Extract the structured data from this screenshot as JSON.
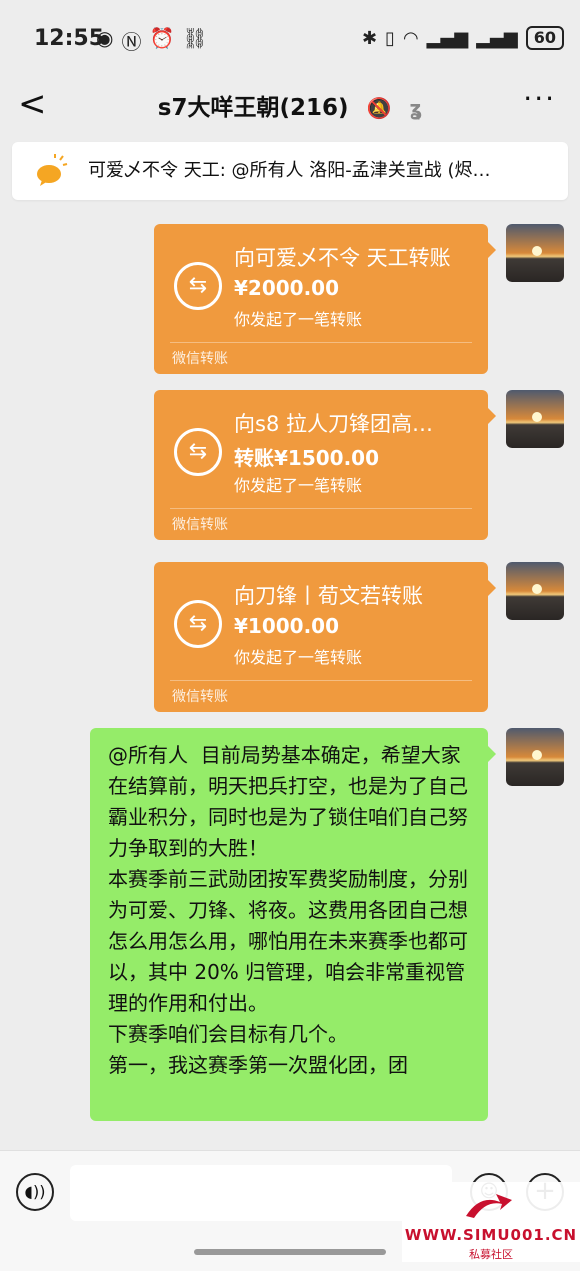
{
  "status": {
    "time": "12:55",
    "battery": "60",
    "left_icons": [
      "eye-icon",
      "nfc-icon",
      "alarm-icon",
      "link-icon"
    ],
    "right_icons": [
      "bluetooth-icon",
      "vibrate-icon",
      "wifi-icon",
      "signal-5g-icon",
      "signal-5g-icon"
    ]
  },
  "nav": {
    "back_glyph": "<",
    "title": "s7大咩王朝(216)",
    "more_glyph": "···"
  },
  "announcement": {
    "text": "可爱乄不令 天工: @所有人 洛阳-孟津关宣战 (烬…"
  },
  "messages": [
    {
      "type": "transfer",
      "title": "向可爱乄不令 天工转账",
      "amount": "¥2000.00",
      "note": "你发起了一笔转账",
      "footer": "微信转账"
    },
    {
      "type": "transfer",
      "title": "向s8 拉人刀锋团高…",
      "amount": "转账¥1500.00",
      "note": "你发起了一笔转账",
      "footer": "微信转账"
    },
    {
      "type": "transfer",
      "title": "向刀锋丨荀文若转账",
      "amount": "¥1000.00",
      "note": "你发起了一笔转账",
      "footer": "微信转账"
    },
    {
      "type": "text",
      "text": "@所有人  目前局势基本确定，希望大家在结算前，明天把兵打空，也是为了自己霸业积分，同时也是为了锁住咱们自己努力争取到的大胜！\n本赛季前三武勋团按军费奖励制度，分别为可爱、刀锋、将夜。这费用各团自己想怎么用怎么用，哪怕用在未来赛季也都可以，其中 20% 归管理，咱会非常重视管理的作用和付出。\n下赛季咱们会目标有几个。\n第一，我这赛季第一次盟化团，团"
    }
  ],
  "watermark": {
    "site": "WWW.SIMU001.CN",
    "sub": "私募社区"
  },
  "colors": {
    "transfer_bg": "#f09a3e",
    "text_bubble_bg": "#95ec69",
    "chat_bg": "#ededed"
  }
}
